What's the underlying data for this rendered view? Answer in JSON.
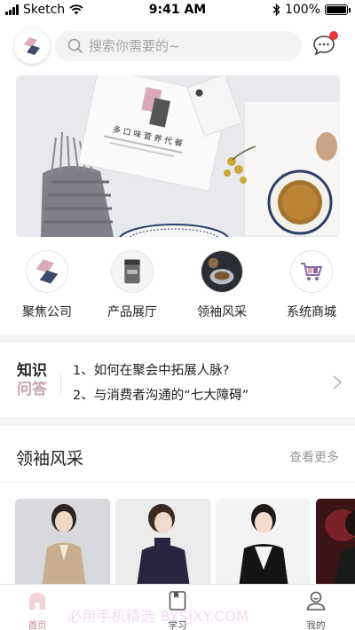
{
  "status_bar": {
    "carrier": "Sketch",
    "time": "9:41 AM",
    "battery": "100%",
    "battery_level": 1.0
  },
  "header": {
    "search_placeholder": "搜索你需要的~",
    "has_unread_message": true
  },
  "categories": [
    {
      "label": "聚焦公司",
      "icon": "brand-logo-icon"
    },
    {
      "label": "产品展厅",
      "icon": "product-package-image"
    },
    {
      "label": "领袖风采",
      "icon": "leader-portrait-image"
    },
    {
      "label": "系统商城",
      "icon": "shopping-cart-icon"
    }
  ],
  "qa": {
    "logo_line1": "知识",
    "logo_line2": "问答",
    "items": [
      "1、如何在聚会中拓展人脉?",
      "2、与消费者沟通的“七大障碍”"
    ]
  },
  "leaders_section": {
    "title": "领袖风采",
    "more": "查看更多"
  },
  "tabbar": {
    "tabs": [
      {
        "label": "首页",
        "icon": "home-icon",
        "active": true
      },
      {
        "label": "学习",
        "icon": "book-icon",
        "active": false
      },
      {
        "label": "我的",
        "icon": "profile-icon",
        "active": false
      }
    ]
  },
  "watermark": "必用手机精选 BYSJXY.COM",
  "colors": {
    "accent": "#c4898f",
    "badge": "#e8363b",
    "brand_pink": "#d9a9b8",
    "brand_navy": "#3b4a6b"
  }
}
